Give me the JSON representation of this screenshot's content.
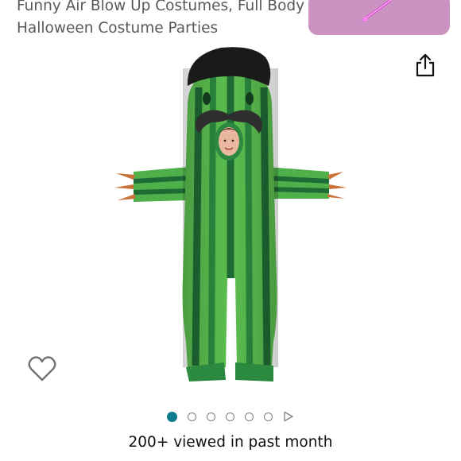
{
  "product": {
    "title_line1": "Funny Air Blow Up Costumes, Full Body Ca",
    "title_line2": "Halloween Costume Parties"
  },
  "gallery": {
    "image_count": 6,
    "active_index": 0,
    "has_video": true
  },
  "icons": {
    "share": "share-icon",
    "wishlist": "heart-icon",
    "video": "play-icon"
  },
  "colors": {
    "accent": "#0f7b8f",
    "title_text": "#565959",
    "body_text": "#0f1111",
    "costume_dark": "#1f6b35",
    "costume_light": "#5cbf4f"
  },
  "social_proof": {
    "viewed_text": "200+ viewed in past month"
  }
}
